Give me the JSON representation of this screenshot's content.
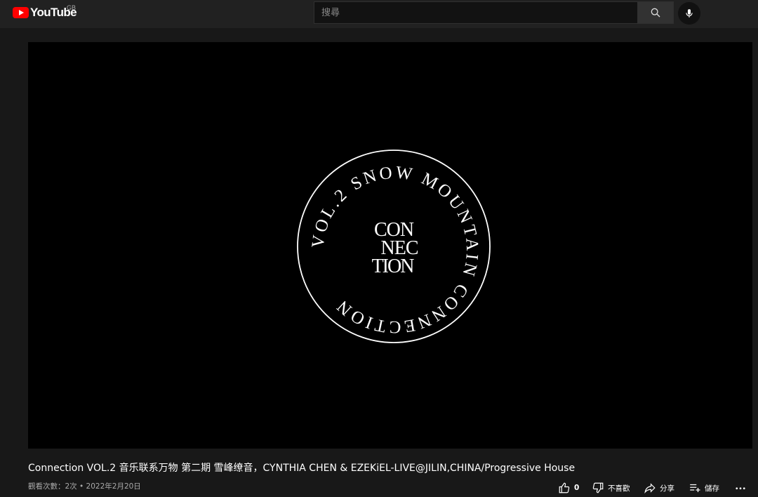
{
  "header": {
    "logo_text": "YouTube",
    "region": "GB",
    "search_placeholder": "搜尋"
  },
  "video": {
    "logo_ring_text": "VOL.2 SNOW MOUNTAIN CONNECTION",
    "logo_line1": "CON",
    "logo_line2": "NEC",
    "logo_line3": "TION",
    "title": "Connection VOL.2 音乐联系万物 第二期 雪峰缭音，CYNTHIA CHEN & EZEKiEL-LIVE@JILIN,CHINA/Progressive House",
    "meta": "觀看次數：2次 • 2022年2月20日"
  },
  "actions": {
    "like_count": "0",
    "dislike_label": "不喜歡",
    "share_label": "分享",
    "save_label": "儲存"
  },
  "icons": [
    "youtube-logo-icon",
    "search-icon",
    "mic-icon",
    "thumb-up-icon",
    "thumb-down-icon",
    "share-icon",
    "playlist-add-icon",
    "more-icon"
  ]
}
